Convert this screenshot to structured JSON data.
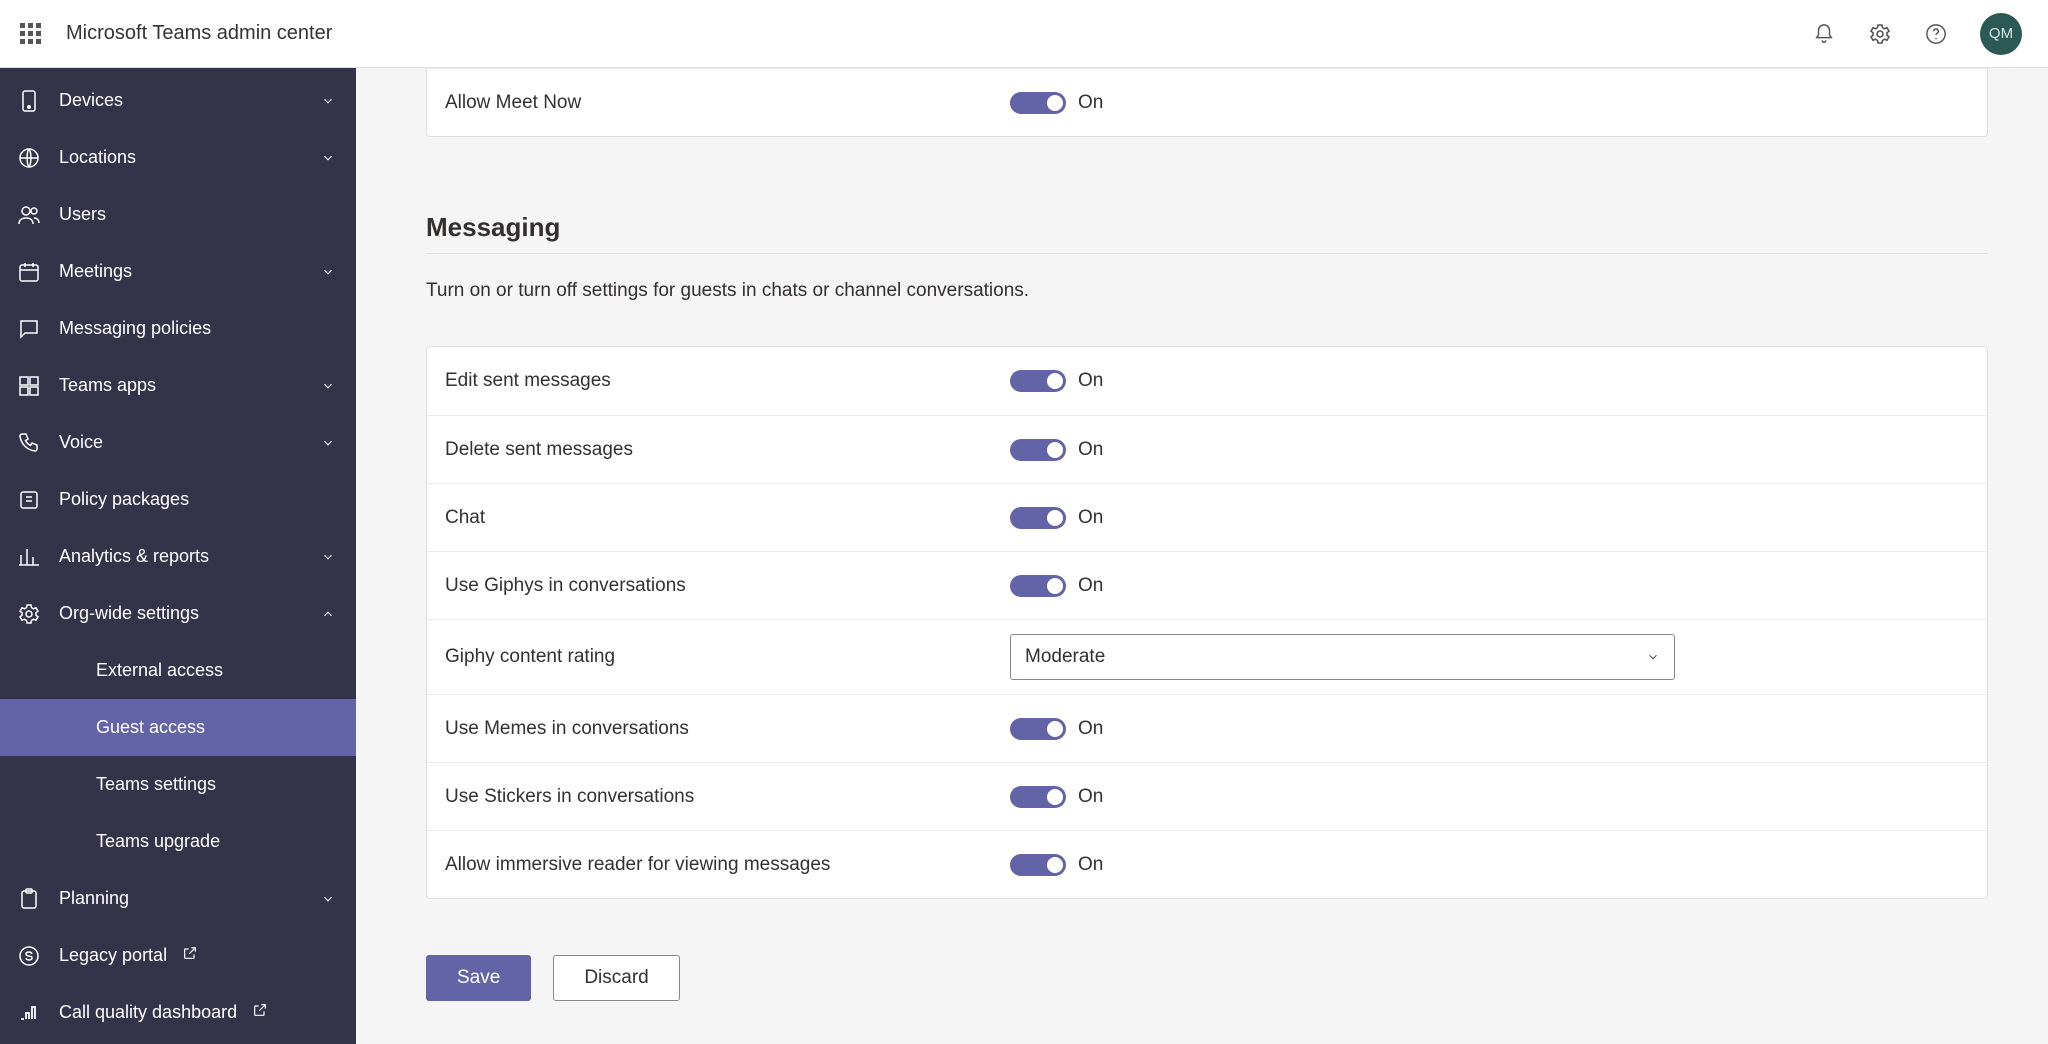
{
  "app": {
    "title": "Microsoft Teams admin center",
    "avatar_initials": "QM"
  },
  "sidebar": {
    "items": [
      {
        "label": "Devices",
        "expandable": true,
        "expanded": false
      },
      {
        "label": "Locations",
        "expandable": true,
        "expanded": false
      },
      {
        "label": "Users",
        "expandable": false
      },
      {
        "label": "Meetings",
        "expandable": true,
        "expanded": false
      },
      {
        "label": "Messaging policies",
        "expandable": false
      },
      {
        "label": "Teams apps",
        "expandable": true,
        "expanded": false
      },
      {
        "label": "Voice",
        "expandable": true,
        "expanded": false
      },
      {
        "label": "Policy packages",
        "expandable": false
      },
      {
        "label": "Analytics & reports",
        "expandable": true,
        "expanded": false
      },
      {
        "label": "Org-wide settings",
        "expandable": true,
        "expanded": true,
        "children": [
          {
            "label": "External access"
          },
          {
            "label": "Guest access",
            "active": true
          },
          {
            "label": "Teams settings"
          },
          {
            "label": "Teams upgrade"
          }
        ]
      },
      {
        "label": "Planning",
        "expandable": true,
        "expanded": false
      },
      {
        "label": "Legacy portal",
        "external": true
      },
      {
        "label": "Call quality dashboard",
        "external": true
      }
    ]
  },
  "preceding_card": {
    "rows": [
      {
        "label": "Allow Meet Now",
        "state": "On"
      }
    ]
  },
  "section": {
    "title": "Messaging",
    "description": "Turn on or turn off settings for guests in chats or channel conversations."
  },
  "messaging_card": {
    "rows": [
      {
        "label": "Edit sent messages",
        "state": "On"
      },
      {
        "label": "Delete sent messages",
        "state": "On"
      },
      {
        "label": "Chat",
        "state": "On"
      },
      {
        "label": "Use Giphys in conversations",
        "state": "On"
      },
      {
        "label": "Giphy content rating",
        "type": "dropdown",
        "value": "Moderate"
      },
      {
        "label": "Use Memes in conversations",
        "state": "On"
      },
      {
        "label": "Use Stickers in conversations",
        "state": "On"
      },
      {
        "label": "Allow immersive reader for viewing messages",
        "state": "On"
      }
    ]
  },
  "actions": {
    "save": "Save",
    "discard": "Discard"
  }
}
